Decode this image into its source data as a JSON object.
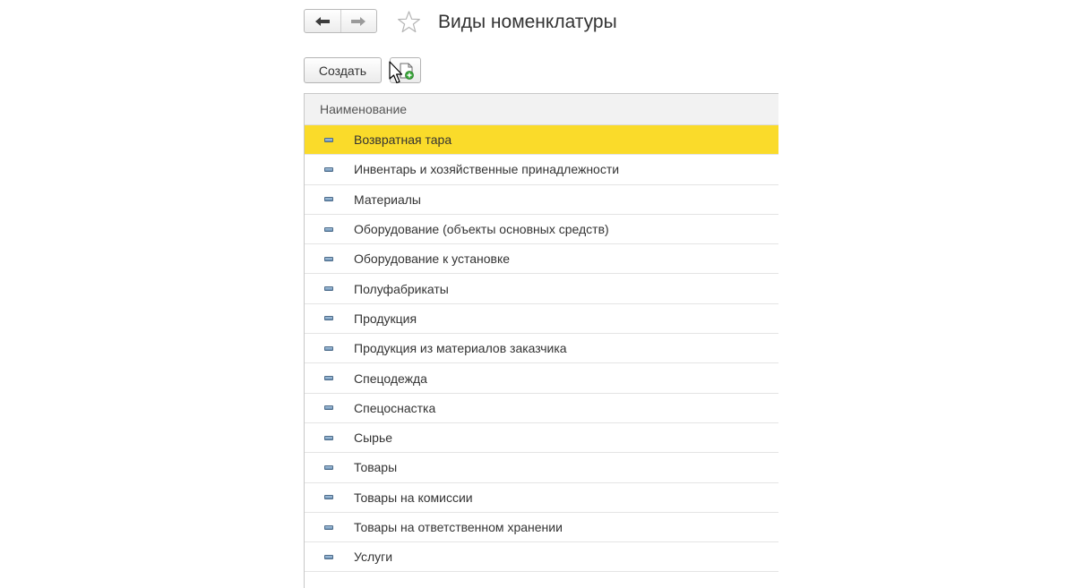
{
  "header": {
    "title": "Виды номенклатуры",
    "back_icon": "arrow-left-icon",
    "forward_icon": "arrow-right-icon",
    "favorite_icon": "star-icon"
  },
  "toolbar": {
    "create_label": "Создать",
    "copy_icon": "copy-document-icon"
  },
  "table": {
    "column_header": "Наименование",
    "selected_index": 0,
    "selected_color": "#fadb2a",
    "rows": [
      "Возвратная тара",
      "Инвентарь и хозяйственные принадлежности",
      "Материалы",
      "Оборудование (объекты основных средств)",
      "Оборудование к установке",
      "Полуфабрикаты",
      "Продукция",
      "Продукция из материалов заказчика",
      "Спецодежда",
      "Спецоснастка",
      "Сырье",
      "Товары",
      "Товары на комиссии",
      "Товары на ответственном хранении",
      "Услуги"
    ]
  }
}
